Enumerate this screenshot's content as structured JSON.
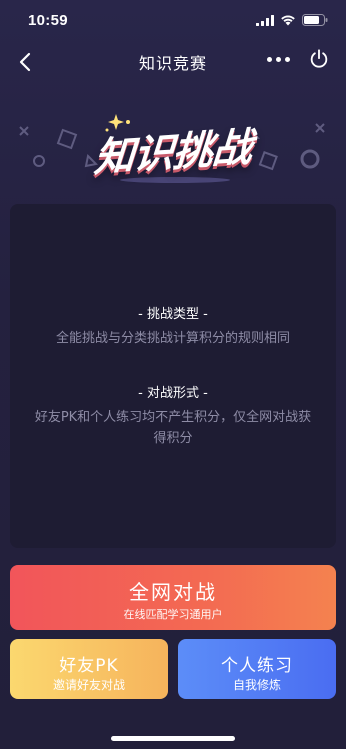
{
  "status_bar": {
    "time": "10:59"
  },
  "nav": {
    "title": "知识竞赛"
  },
  "hero": {
    "title": "知识挑战"
  },
  "rules": {
    "section1_heading": "- 挑战类型 -",
    "section1_text": "全能挑战与分类挑战计算积分的规则相同",
    "section2_heading": "- 对战形式 -",
    "section2_text": "好友PK和个人练习均不产生积分，仅全网对战获得积分"
  },
  "buttons": {
    "main": {
      "label": "全网对战",
      "sub": "在线匹配学习通用户"
    },
    "friend": {
      "label": "好友PK",
      "sub": "邀请好友对战"
    },
    "solo": {
      "label": "个人练习",
      "sub": "自我修炼"
    }
  },
  "colors": {
    "background": "#24213f",
    "card": "#1e1c33",
    "main_button": "#f2555a",
    "friend_button": "#f6b35c",
    "solo_button": "#4a6df1"
  }
}
